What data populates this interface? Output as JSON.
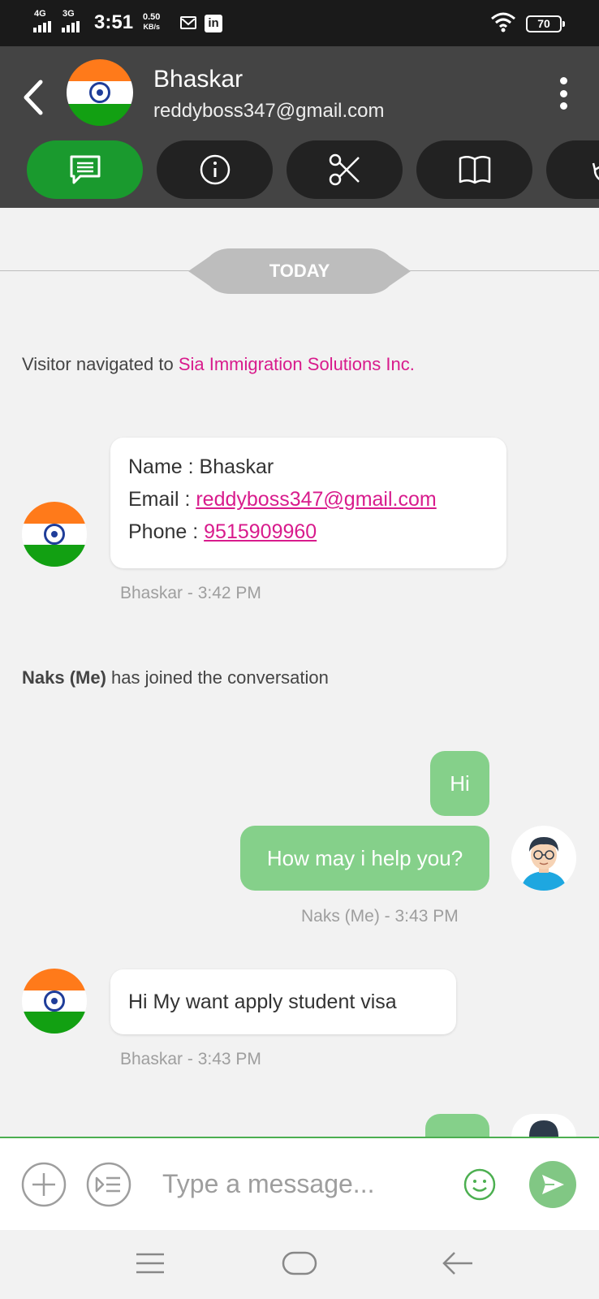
{
  "status_bar": {
    "network_1": "4G",
    "network_2": "3G",
    "time": "3:51",
    "speed_value": "0.50",
    "speed_unit": "KB/s",
    "battery": "70",
    "icons": [
      "gmail-icon",
      "linkedin-icon",
      "wifi-icon",
      "battery-icon"
    ]
  },
  "header": {
    "contact_name": "Bhaskar",
    "contact_email": "reddyboss347@gmail.com",
    "tabs": [
      "chat-tab",
      "info-tab",
      "cut-tab",
      "book-tab",
      "history-tab"
    ],
    "accent_color": "#1a9a2e",
    "header_bg": "#444444"
  },
  "chat": {
    "date_label": "TODAY",
    "visitor_nav_prefix": "Visitor navigated to ",
    "visitor_nav_site": "Sia Immigration Solutions Inc.",
    "lead_card": {
      "name_label": "Name : ",
      "name_value": "Bhaskar",
      "email_label": "Email : ",
      "email_value": "reddyboss347@gmail.com",
      "phone_label": "Phone : ",
      "phone_value": "9515909960"
    },
    "lead_meta": "Bhaskar - 3:42 PM",
    "join_bold": "Naks (Me)",
    "join_text": " has joined the conversation",
    "out_msg_1": "Hi",
    "out_msg_2": "How may i help you?",
    "out_meta": "Naks (Me) - 3:43 PM",
    "in_msg_1": "Hi My want apply student visa",
    "in_meta": "Bhaskar - 3:43 PM",
    "link_color": "#d81b8c",
    "out_bubble_color": "#85d08a"
  },
  "input": {
    "placeholder": "Type a message..."
  }
}
